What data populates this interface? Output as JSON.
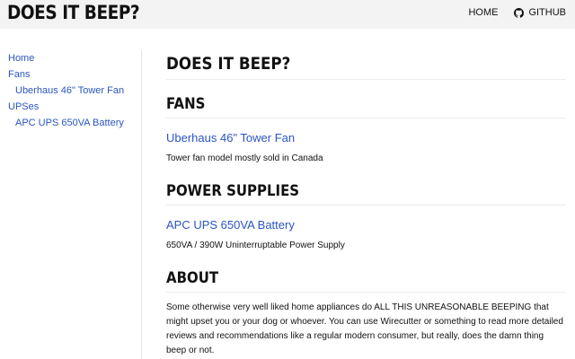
{
  "header": {
    "site_title": "DOES IT BEEP?",
    "nav_home": "HOME",
    "nav_github": "GITHUB"
  },
  "sidebar": {
    "items": [
      {
        "label": "Home"
      },
      {
        "label": "Fans"
      },
      {
        "label": "Uberhaus 46\" Tower Fan"
      },
      {
        "label": "UPSes"
      },
      {
        "label": "APC UPS 650VA Battery"
      }
    ]
  },
  "main": {
    "page_title": "DOES IT BEEP?",
    "sections": [
      {
        "heading": "FANS",
        "item_title": "Uberhaus 46\" Tower Fan",
        "item_desc": "Tower fan model mostly sold in Canada"
      },
      {
        "heading": "POWER SUPPLIES",
        "item_title": "APC UPS 650VA Battery",
        "item_desc": "650VA / 390W Uninterruptable Power Supply"
      }
    ],
    "about": {
      "heading": "ABOUT",
      "text": "Some otherwise very well liked home appliances do ALL THIS UNREASONABLE BEEPING that might upset you or your dog or whoever. You can use Wirecutter or something to read more detailed reviews and recommendations like a regular modern consumer, but really, does the damn thing beep or not."
    }
  },
  "colors": {
    "link": "#2a55c4",
    "header_bg": "#f3f3f3",
    "text": "#111111"
  },
  "icons": {
    "github": "github-icon"
  }
}
